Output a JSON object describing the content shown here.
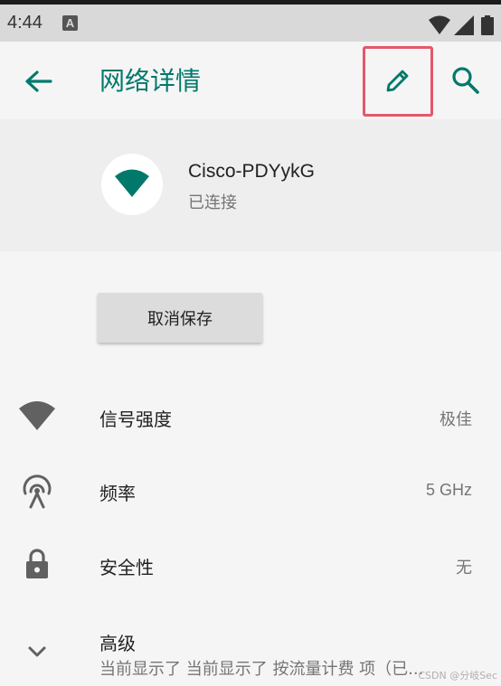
{
  "status_bar": {
    "time": "4:44",
    "notification_icon_letter": "A",
    "icons": [
      "wifi-signal-icon",
      "cell-signal-icon",
      "battery-icon"
    ]
  },
  "app_bar": {
    "title": "网络详情",
    "back_icon": "arrow-back-icon",
    "edit_icon": "pencil-icon",
    "search_icon": "search-icon",
    "accent_color": "#00796b",
    "edit_highlight_color": "#e4576a"
  },
  "network": {
    "ssid": "Cisco-PDYykG",
    "status": "已连接"
  },
  "forget_button": {
    "label": "取消保存"
  },
  "details": [
    {
      "icon": "wifi-strength-icon",
      "label": "信号强度",
      "value": "极佳"
    },
    {
      "icon": "frequency-icon",
      "label": "频率",
      "value": "5 GHz"
    },
    {
      "icon": "lock-icon",
      "label": "安全性",
      "value": "无"
    }
  ],
  "advanced": {
    "label": "高级",
    "summary": "当前显示了 当前显示了 按流量计费 项（已...",
    "icon": "chevron-down-icon"
  },
  "watermark": "CSDN @分岐Sec"
}
